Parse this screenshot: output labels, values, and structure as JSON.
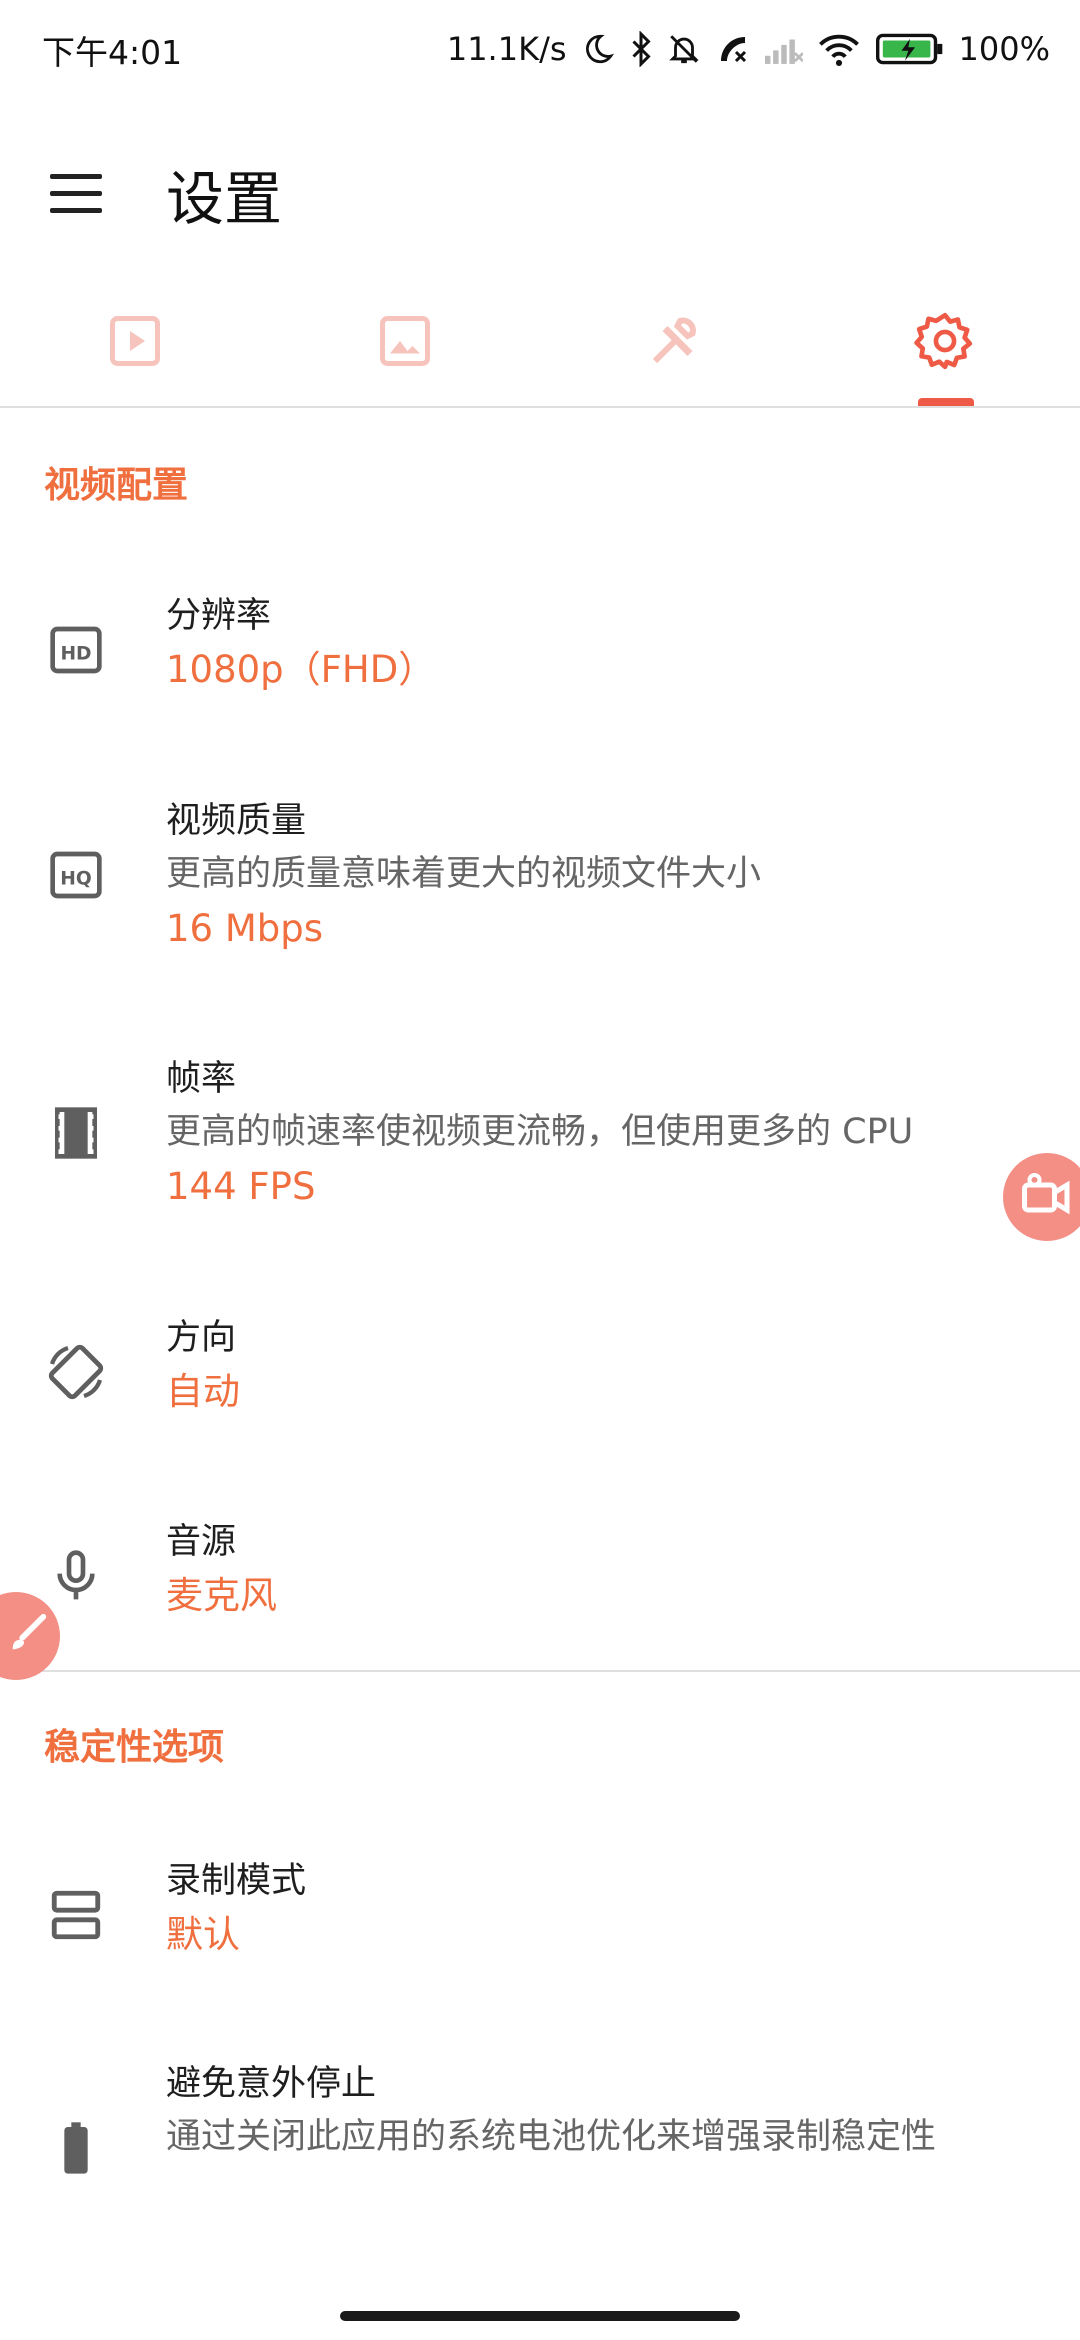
{
  "status_bar": {
    "time": "下午4:01",
    "network_speed": "11.1K/s",
    "battery_level": "100%",
    "icons": [
      "moon-icon",
      "bluetooth-icon",
      "bell-off-icon",
      "call-icon",
      "signal-icon",
      "wifi-icon",
      "battery-charging-icon"
    ]
  },
  "app_bar": {
    "title": "设置",
    "menu_icon": "hamburger-menu-icon"
  },
  "tabs": [
    {
      "icon": "video-play-icon",
      "selected": false
    },
    {
      "icon": "image-icon",
      "selected": false
    },
    {
      "icon": "tools-icon",
      "selected": false
    },
    {
      "icon": "settings-gear-icon",
      "selected": true
    }
  ],
  "sections": {
    "video": {
      "title": "视频配置",
      "items": [
        {
          "icon": "hd-icon",
          "title": "分辨率",
          "value": "1080p（FHD）"
        },
        {
          "icon": "hq-icon",
          "title": "视频质量",
          "desc": "更高的质量意味着更大的视频文件大小",
          "value": "16 Mbps"
        },
        {
          "icon": "film-strip-icon",
          "title": "帧率",
          "desc": "更高的帧速率使视频更流畅，但使用更多的 CPU",
          "value": "144 FPS"
        },
        {
          "icon": "screen-rotation-icon",
          "title": "方向",
          "value": "自动"
        },
        {
          "icon": "microphone-icon",
          "title": "音源",
          "value": "麦克风"
        }
      ]
    },
    "stability": {
      "title": "稳定性选项",
      "items": [
        {
          "icon": "split-view-icon",
          "title": "录制模式",
          "value": "默认"
        },
        {
          "icon": "battery-icon",
          "title": "避免意外停止",
          "desc": "通过关闭此应用的系统电池优化来增强录制稳定性"
        }
      ]
    }
  },
  "colors": {
    "accent": "#f06f3f",
    "tab_indicator": "#ee5a46",
    "tab_inactive": "#f6c4bc",
    "bubble": "#f48f86",
    "icon": "#5f5f5f"
  }
}
